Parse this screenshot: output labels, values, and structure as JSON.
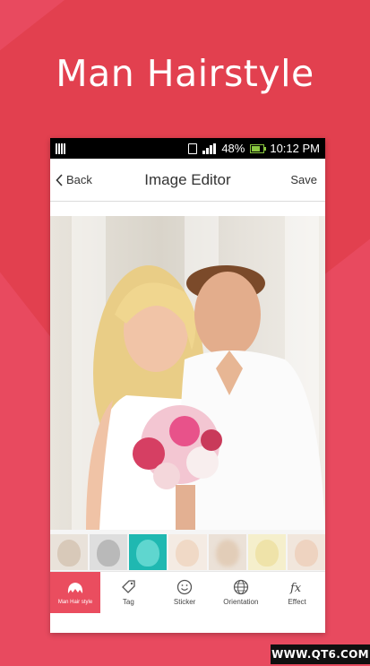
{
  "headline": "Man Hairstyle",
  "status_bar": {
    "battery": "48%",
    "time": "10:12 PM"
  },
  "app_bar": {
    "back_label": "Back",
    "title": "Image Editor",
    "save_label": "Save"
  },
  "thumbnails": [
    {
      "name": "filter-normal",
      "tint": "#d8c9b9"
    },
    {
      "name": "filter-gray",
      "tint": "#c9c9c9"
    },
    {
      "name": "filter-cyan",
      "tint": "#2fc9c1"
    },
    {
      "name": "filter-warm",
      "tint": "#f0d9c6"
    },
    {
      "name": "filter-blur",
      "tint": "#e2cdb8"
    },
    {
      "name": "filter-yellow",
      "tint": "#efe3a9"
    },
    {
      "name": "filter-vintage",
      "tint": "#eed3c0"
    }
  ],
  "toolbar": {
    "items": [
      {
        "label": "Man Hair style",
        "icon": "hair-icon",
        "active": true
      },
      {
        "label": "Tag",
        "icon": "tag-icon",
        "active": false
      },
      {
        "label": "Sticker",
        "icon": "smiley-icon",
        "active": false
      },
      {
        "label": "Orientation",
        "icon": "globe-icon",
        "active": false
      },
      {
        "label": "Effect",
        "icon": "fx-icon",
        "active": false
      }
    ]
  },
  "watermark": "WWW.QT6.COM",
  "colors": {
    "background": "#e84a5f",
    "accent": "#ea4d5f"
  }
}
